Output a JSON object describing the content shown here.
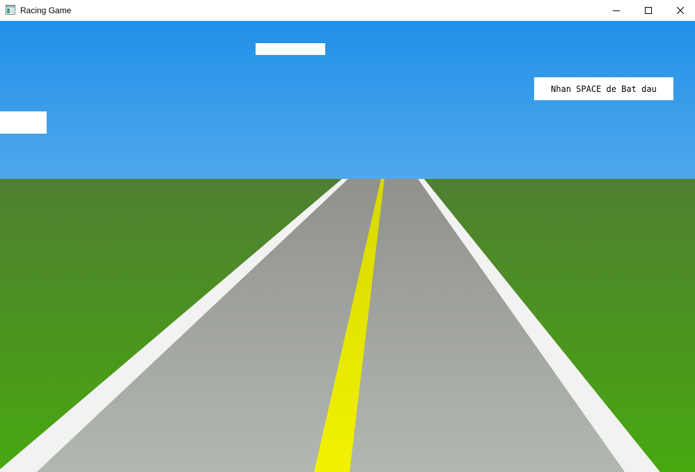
{
  "window": {
    "title": "Racing Game",
    "icon": "app-window-icon",
    "controls": {
      "minimize_icon": "minimize-icon",
      "maximize_icon": "maximize-icon",
      "close_icon": "close-icon"
    }
  },
  "hud": {
    "start_prompt": "Nhan SPACE de Bat dau"
  },
  "colors": {
    "sky_top": "#2090e8",
    "sky_bottom": "#50a8ec",
    "grass_top": "#4f7f31",
    "grass_bottom": "#48a810",
    "road_top": "#8f918d",
    "road_bottom": "#b3b7b1",
    "road_edge": "#f2f2f2",
    "center_line_top": "#d7d700",
    "center_line_bottom": "#f2f200",
    "cloud": "#ffffff"
  }
}
